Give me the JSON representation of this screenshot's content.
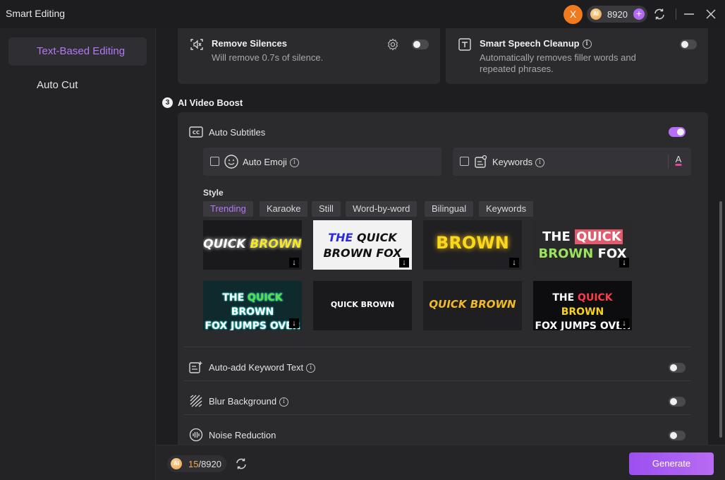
{
  "app": {
    "title": "Smart Editing"
  },
  "titlebar": {
    "avatar_letter": "X",
    "credits": "8920",
    "plus": "+"
  },
  "sidebar": {
    "items": [
      {
        "label": "Text-Based Editing",
        "active": true
      },
      {
        "label": "Auto Cut",
        "active": false
      }
    ]
  },
  "top_cards": {
    "remove_silences": {
      "title": "Remove Silences",
      "desc": "Will remove 0.7s of silence.",
      "enabled": false
    },
    "speech_cleanup": {
      "title": "Smart Speech Cleanup",
      "desc_line1": "Automatically removes filler words and",
      "desc_line2": "repeated phrases.",
      "enabled": false
    }
  },
  "ai_boost": {
    "step": "3",
    "heading": "AI Video Boost",
    "auto_subtitles": {
      "label": "Auto Subtitles",
      "enabled": true
    },
    "auto_emoji": {
      "label": "Auto Emoji",
      "checked": false
    },
    "keywords": {
      "label": "Keywords",
      "checked": false,
      "color_glyph": "A"
    },
    "style": {
      "label": "Style",
      "tabs": [
        "Trending",
        "Karaoke",
        "Still",
        "Word-by-word",
        "Bilingual",
        "Keywords"
      ],
      "active_tab": "Trending",
      "thumbnails": [
        {
          "line1": "QUICK BROWN",
          "line2": ""
        },
        {
          "line1": "THE QUICK",
          "line2": "BROWN FOX"
        },
        {
          "line1": "BROWN",
          "line2": ""
        },
        {
          "line1": "THE QUICK",
          "line2": "BROWN FOX"
        },
        {
          "line1": "THE QUICK BROWN",
          "line2": "FOX JUMPS OVER"
        },
        {
          "line1": "QUICK BROWN",
          "line2": ""
        },
        {
          "line1": "QUICK BROWN",
          "line2": ""
        },
        {
          "line1": "THE QUICK BROWN",
          "line2": "FOX JUMPS OVER"
        }
      ]
    },
    "auto_keyword_text": {
      "label": "Auto-add Keyword Text",
      "enabled": false
    },
    "blur_background": {
      "label": "Blur Background",
      "enabled": false
    },
    "noise_reduction": {
      "label": "Noise Reduction",
      "enabled": false
    }
  },
  "bottom": {
    "used": "15",
    "total": "/8920",
    "generate_label": "Generate"
  },
  "colors": {
    "accent": "#b477f5",
    "generate": "#a35ef1",
    "avatar": "#f07a1d"
  }
}
